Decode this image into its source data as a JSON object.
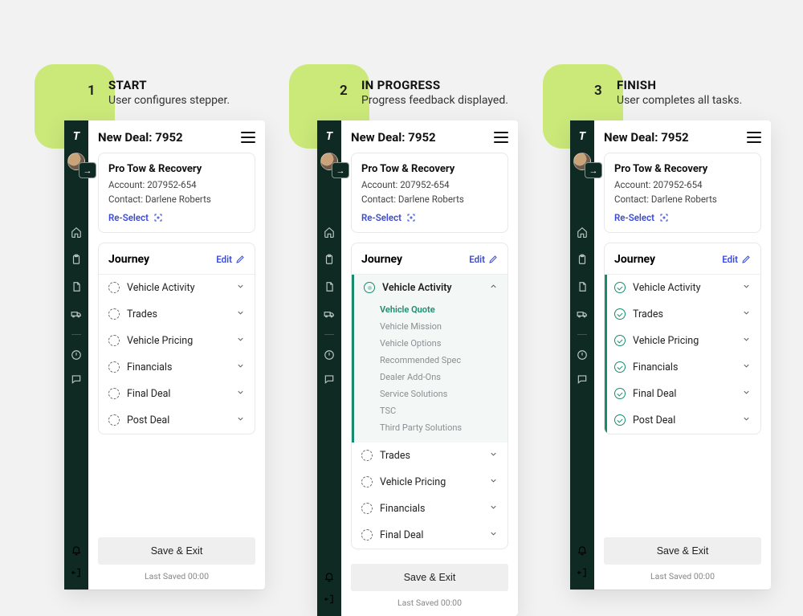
{
  "colors": {
    "accent": "#1a8c6d",
    "link": "#3b4bd8",
    "chip": "#cbe979",
    "rail": "#0f2a23"
  },
  "stages": [
    {
      "num": "1",
      "title": "START",
      "subtitle": "User configures stepper."
    },
    {
      "num": "2",
      "title": "IN PROGRESS",
      "subtitle": "Progress feedback displayed."
    },
    {
      "num": "3",
      "title": "FINISH",
      "subtitle": "User completes all tasks."
    }
  ],
  "common": {
    "page_title": "New Deal: 7952",
    "customer": {
      "name": "Pro Tow & Recovery",
      "account_label": "Account: 207952-654",
      "contact_label": "Contact: Darlene Roberts",
      "reselect_label": "Re-Select"
    },
    "journey": {
      "title": "Journey",
      "edit_label": "Edit"
    },
    "save_button": "Save & Exit",
    "last_saved": "Last Saved 00:00",
    "rail_icons": {
      "logo": "T",
      "mid": [
        "home",
        "clipboard",
        "document",
        "truck"
      ],
      "lower": [
        "alert",
        "chat"
      ],
      "bottom": [
        "bell",
        "logout"
      ],
      "expand": "arrow-right"
    }
  },
  "panels": {
    "start": {
      "steps": [
        {
          "label": "Vehicle Activity",
          "status": "pending"
        },
        {
          "label": "Trades",
          "status": "pending"
        },
        {
          "label": "Vehicle Pricing",
          "status": "pending"
        },
        {
          "label": "Financials",
          "status": "pending"
        },
        {
          "label": "Final Deal",
          "status": "pending"
        },
        {
          "label": "Post Deal",
          "status": "pending"
        }
      ]
    },
    "in_progress": {
      "active_step": "Vehicle Activity",
      "sub_items": [
        {
          "label": "Vehicle Quote",
          "active": true
        },
        {
          "label": "Vehicle Mission",
          "active": false
        },
        {
          "label": "Vehicle Options",
          "active": false
        },
        {
          "label": "Recommended Spec",
          "active": false
        },
        {
          "label": "Dealer Add-Ons",
          "active": false
        },
        {
          "label": "Service Solutions",
          "active": false
        },
        {
          "label": "TSC",
          "active": false
        },
        {
          "label": "Third Party Solutions",
          "active": false
        }
      ],
      "remaining_steps": [
        {
          "label": "Trades",
          "status": "pending"
        },
        {
          "label": "Vehicle Pricing",
          "status": "pending"
        },
        {
          "label": "Financials",
          "status": "pending"
        },
        {
          "label": "Final Deal",
          "status": "pending"
        }
      ]
    },
    "finish": {
      "steps": [
        {
          "label": "Vehicle Activity",
          "status": "done"
        },
        {
          "label": "Trades",
          "status": "done"
        },
        {
          "label": "Vehicle Pricing",
          "status": "done"
        },
        {
          "label": "Financials",
          "status": "done"
        },
        {
          "label": "Final Deal",
          "status": "done"
        },
        {
          "label": "Post Deal",
          "status": "done"
        }
      ]
    }
  }
}
